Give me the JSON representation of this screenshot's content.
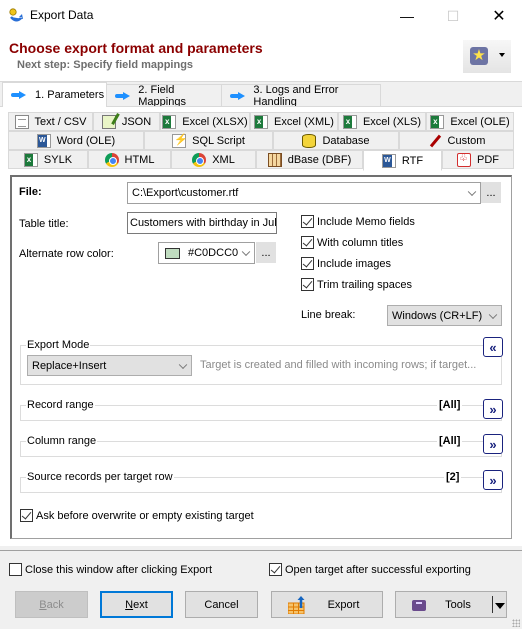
{
  "window": {
    "title": "Export Data",
    "minimize_glyph": "—",
    "maximize_glyph": "☐",
    "close_glyph": "✕"
  },
  "header": {
    "title": "Choose export format and parameters",
    "subtitle": "Next step: Specify field mappings",
    "favorites_icon": "star-icon",
    "colors": {
      "title": "#8B0000",
      "subtitle": "#6E6E6E"
    }
  },
  "steps": [
    {
      "label": "1. Parameters",
      "active": true
    },
    {
      "label": "2. Field Mappings",
      "active": false
    },
    {
      "label": "3. Logs and Error Handling",
      "active": false
    }
  ],
  "format_tabs": {
    "row1": [
      {
        "label": "Text / CSV",
        "icon": "text-file-icon"
      },
      {
        "label": "JSON",
        "icon": "json-icon"
      },
      {
        "label": "Excel (XLSX)",
        "icon": "excel-icon"
      },
      {
        "label": "Excel (XML)",
        "icon": "excel-icon"
      },
      {
        "label": "Excel (XLS)",
        "icon": "excel-icon"
      },
      {
        "label": "Excel (OLE)",
        "icon": "excel-icon"
      }
    ],
    "row2": [
      {
        "label": "Word (OLE)",
        "icon": "word-icon"
      },
      {
        "label": "SQL Script",
        "icon": "sql-script-icon"
      },
      {
        "label": "Database",
        "icon": "database-icon"
      },
      {
        "label": "Custom",
        "icon": "custom-pen-icon"
      }
    ],
    "row3": [
      {
        "label": "SYLK",
        "icon": "sylk-icon"
      },
      {
        "label": "HTML",
        "icon": "chrome-icon"
      },
      {
        "label": "XML",
        "icon": "chrome-icon"
      },
      {
        "label": "dBase (DBF)",
        "icon": "dbf-table-icon"
      },
      {
        "label": "RTF",
        "icon": "word-icon",
        "active": true
      },
      {
        "label": "PDF",
        "icon": "pdf-icon"
      }
    ]
  },
  "form": {
    "file_label": "File:",
    "file_value": "C:\\Export\\customer.rtf",
    "browse_label": "...",
    "table_title_label": "Table title:",
    "table_title_value": "Customers with birthday in Jul",
    "alt_row_color_label": "Alternate row color:",
    "alt_row_color_value": "#C0DCC0",
    "alt_row_color_swatch": "#C0DCC0",
    "color_browse_label": "...",
    "checkboxes": [
      {
        "label": "Include Memo fields",
        "checked": true
      },
      {
        "label": "With column titles",
        "checked": true
      },
      {
        "label": "Include images",
        "checked": true
      },
      {
        "label": "Trim trailing spaces",
        "checked": true
      }
    ],
    "line_break_label": "Line break:",
    "line_break_value": "Windows (CR+LF)"
  },
  "export_mode": {
    "legend": "Export Mode",
    "value": "Replace+Insert",
    "description": "Target is created and filled with incoming rows; if target...",
    "collapse_glyph": "«"
  },
  "ranges": [
    {
      "label": "Record range",
      "value": "[All]",
      "expand_glyph": "»"
    },
    {
      "label": "Column range",
      "value": "[All]",
      "expand_glyph": "»"
    },
    {
      "label": "Source records per target row",
      "value": "[2]",
      "expand_glyph": "»"
    }
  ],
  "ask_overwrite": {
    "label": "Ask before overwrite or empty existing target",
    "checked": true
  },
  "footer": {
    "close_after_export": {
      "label": "Close this window after clicking Export",
      "checked": false
    },
    "open_target": {
      "label": "Open target after successful exporting",
      "checked": true
    },
    "buttons": {
      "back_hotkey": "B",
      "back_rest": "ack",
      "next_hotkey": "N",
      "next_rest": "ext",
      "cancel": "Cancel",
      "export": "Export",
      "tools": "Tools"
    }
  }
}
